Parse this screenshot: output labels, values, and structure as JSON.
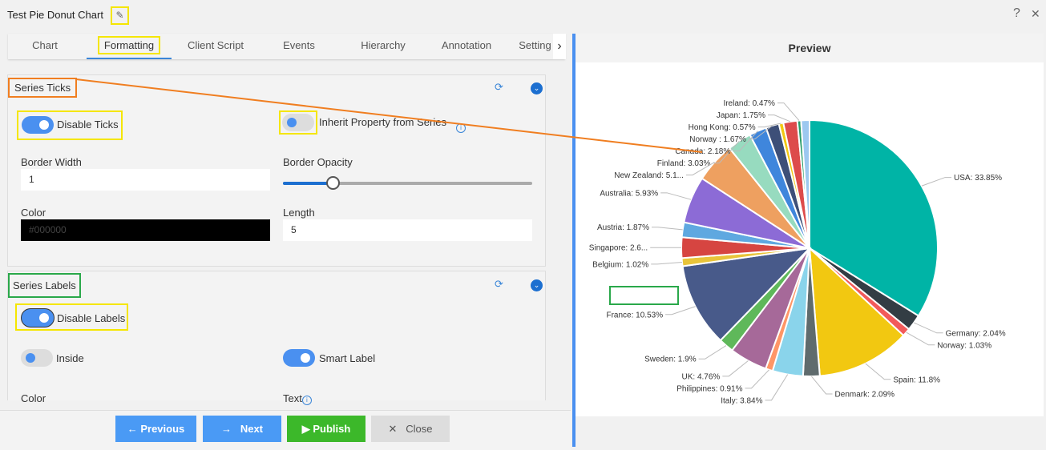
{
  "window": {
    "title": "Test Pie Donut Chart",
    "edit_icon": "edit-icon",
    "help": "?",
    "close": "✕"
  },
  "tabs": [
    {
      "label": "Chart"
    },
    {
      "label": "Formatting",
      "active": true
    },
    {
      "label": "Client Script"
    },
    {
      "label": "Events"
    },
    {
      "label": "Hierarchy"
    },
    {
      "label": "Annotation"
    },
    {
      "label": "Setting"
    }
  ],
  "series_ticks": {
    "title": "Series Ticks",
    "disable_ticks": {
      "label": "Disable Ticks",
      "on": true
    },
    "inherit": {
      "label": "Inherit Property from Series",
      "on": false
    },
    "border_width": {
      "label": "Border Width",
      "value": "1"
    },
    "border_opacity": {
      "label": "Border Opacity",
      "value": 0.2
    },
    "color": {
      "label": "Color",
      "value": "#000000"
    },
    "length": {
      "label": "Length",
      "value": "5"
    }
  },
  "series_labels": {
    "title": "Series Labels",
    "disable_labels": {
      "label": "Disable Labels",
      "on": true
    },
    "inside": {
      "label": "Inside",
      "on": false
    },
    "smart_label": {
      "label": "Smart Label",
      "on": true
    },
    "color_label": "Color",
    "text_label": "Text"
  },
  "footer": {
    "previous": "Previous",
    "next": "Next",
    "publish": "Publish",
    "close": "Close"
  },
  "preview": {
    "title": "Preview"
  },
  "colors": {
    "accent": "#4a90f0",
    "publish": "#3cb82a",
    "tab_underline": "#3a86d8"
  },
  "chart_data": {
    "type": "pie",
    "start": "top, clockwise",
    "slices": [
      {
        "name": "USA",
        "label": "USA: 33.85%",
        "value": 33.85,
        "color": "#00b4a6"
      },
      {
        "name": "Germany",
        "label": "Germany: 2.04%",
        "value": 2.04,
        "color": "#333d44"
      },
      {
        "name": "Norway",
        "label": "Norway: 1.03%",
        "value": 1.03,
        "color": "#f25a5a"
      },
      {
        "name": "Spain",
        "label": "Spain: 11.8%",
        "value": 11.8,
        "color": "#f2c811"
      },
      {
        "name": "Denmark",
        "label": "Denmark: 2.09%",
        "value": 2.09,
        "color": "#5f6b6d"
      },
      {
        "name": "Italy",
        "label": "Italy: 3.84%",
        "value": 3.84,
        "color": "#8ad4eb"
      },
      {
        "name": "Philippines",
        "label": "Philippines: 0.91%",
        "value": 0.91,
        "color": "#fe9666"
      },
      {
        "name": "UK",
        "label": "UK: 4.76%",
        "value": 4.76,
        "color": "#a66999"
      },
      {
        "name": "Sweden",
        "label": "Sweden: 1.9%",
        "value": 1.9,
        "color": "#5fb85a"
      },
      {
        "name": "France",
        "label": "France: 10.53%",
        "value": 10.53,
        "color": "#485a8a"
      },
      {
        "name": "Belgium",
        "label": "Belgium: 1.02%",
        "value": 1.02,
        "color": "#e8c43a"
      },
      {
        "name": "Singapore",
        "label": "Singapore: 2.6...",
        "value": 2.6,
        "color": "#d64541"
      },
      {
        "name": "Austria",
        "label": "Austria: 1.87%",
        "value": 1.87,
        "color": "#5fa8e0"
      },
      {
        "name": "Australia",
        "label": "Australia: 5.93%",
        "value": 5.93,
        "color": "#8c6bd6"
      },
      {
        "name": "New Zealand",
        "label": "New Zealand: 5.1...",
        "value": 5.1,
        "color": "#eea060"
      },
      {
        "name": "Finland",
        "label": "Finland: 3.03%",
        "value": 3.03,
        "color": "#97dbbf"
      },
      {
        "name": "Canada",
        "label": "Canada: 2.18%",
        "value": 2.18,
        "color": "#3f86dc"
      },
      {
        "name": "Norway ",
        "label": "Norway : 1.67%",
        "value": 1.67,
        "color": "#3d4f78"
      },
      {
        "name": "Hong Kong",
        "label": "Hong Kong: 0.57%",
        "value": 0.57,
        "color": "#f2c811"
      },
      {
        "name": "Japan",
        "label": "Japan: 1.75%",
        "value": 1.75,
        "color": "#dd4b4b"
      },
      {
        "name": "Ireland",
        "label": "Ireland: 0.47%",
        "value": 0.47,
        "color": "#2a9d6a"
      },
      {
        "name": "",
        "label": "",
        "value": 1.06,
        "color": "#9cc8f0"
      }
    ]
  }
}
